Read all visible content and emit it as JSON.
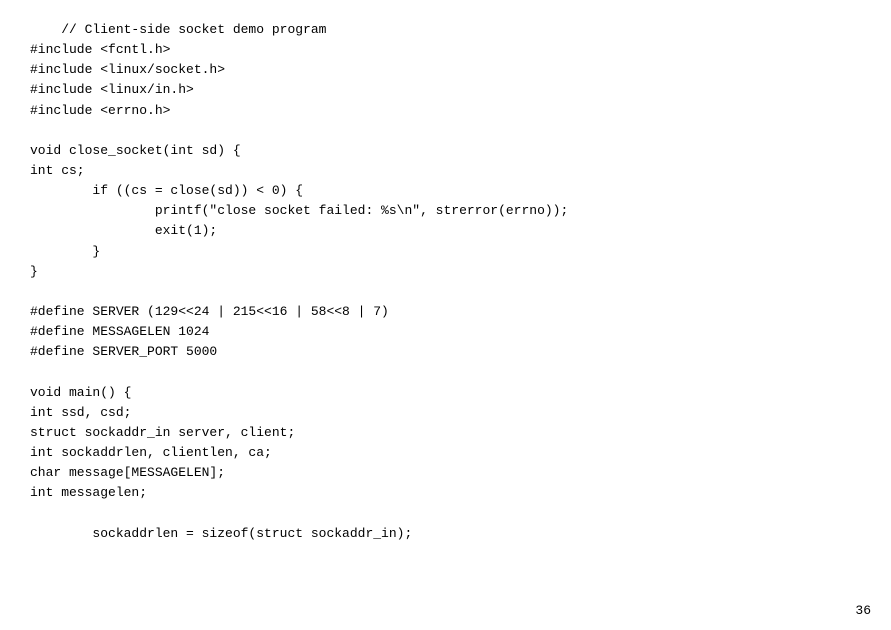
{
  "page": {
    "number": "36",
    "code_lines": [
      "    // Client-side socket demo program",
      "#include <fcntl.h>",
      "#include <linux/socket.h>",
      "#include <linux/in.h>",
      "#include <errno.h>",
      "",
      "void close_socket(int sd) {",
      "int cs;",
      "        if ((cs = close(sd)) < 0) {",
      "                printf(\"close socket failed: %s\\n\", strerror(errno));",
      "                exit(1);",
      "        }",
      "}",
      "",
      "#define SERVER (129<<24 | 215<<16 | 58<<8 | 7)",
      "#define MESSAGELEN 1024",
      "#define SERVER_PORT 5000",
      "",
      "void main() {",
      "int ssd, csd;",
      "struct sockaddr_in server, client;",
      "int sockaddrlen, clientlen, ca;",
      "char message[MESSAGELEN];",
      "int messagelen;",
      "",
      "        sockaddrlen = sizeof(struct sockaddr_in);"
    ]
  }
}
